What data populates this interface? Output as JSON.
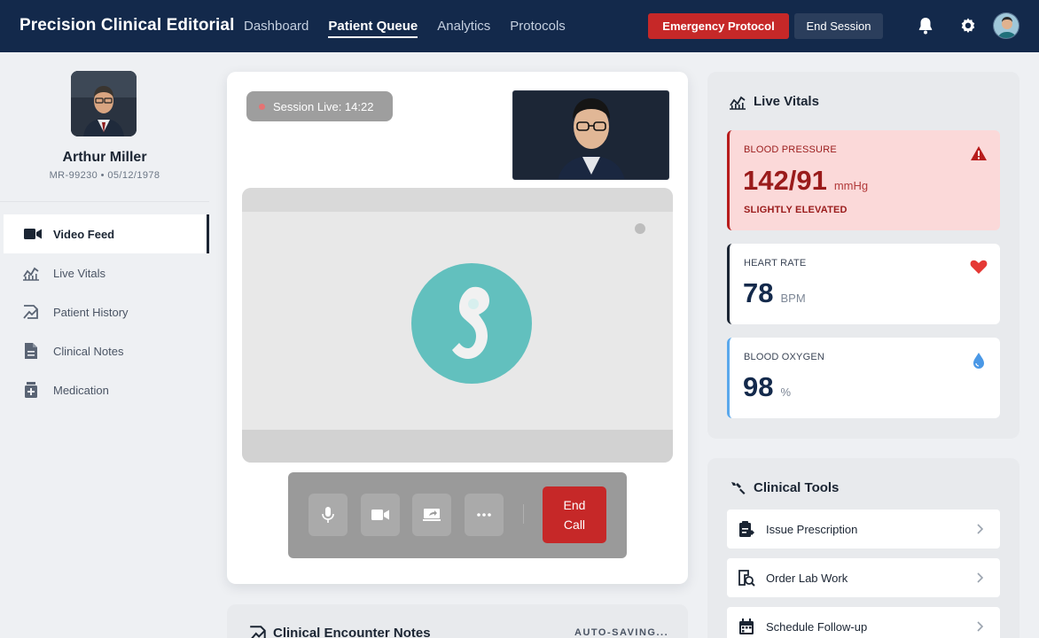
{
  "app": {
    "title": "Precision Clinical Editorial"
  },
  "nav": [
    {
      "label": "Dashboard",
      "active": false
    },
    {
      "label": "Patient Queue",
      "active": true
    },
    {
      "label": "Analytics",
      "active": false
    },
    {
      "label": "Protocols",
      "active": false
    }
  ],
  "header": {
    "emergency_label": "Emergency Protocol",
    "end_session_label": "End Session"
  },
  "patient": {
    "name": "Arthur Miller",
    "meta": "MR-99230 • 05/12/1978"
  },
  "sidebar": {
    "items": [
      {
        "label": "Video Feed",
        "icon": "video-icon",
        "active": true
      },
      {
        "label": "Live Vitals",
        "icon": "vitals-chart-icon",
        "active": false
      },
      {
        "label": "Patient History",
        "icon": "history-icon",
        "active": false
      },
      {
        "label": "Clinical Notes",
        "icon": "document-icon",
        "active": false
      },
      {
        "label": "Medication",
        "icon": "medication-icon",
        "active": false
      }
    ]
  },
  "video": {
    "session_label": "Session Live: 14:22",
    "end_call_label": "End\nCall"
  },
  "notes": {
    "title": "Clinical Encounter Notes",
    "status": "AUTO-SAVING..."
  },
  "vitals": {
    "title": "Live Vitals",
    "blood_pressure": {
      "label": "BLOOD PRESSURE",
      "value": "142/91",
      "unit": "mmHg",
      "status": "SLIGHTLY ELEVATED"
    },
    "heart_rate": {
      "label": "HEART RATE",
      "value": "78",
      "unit": "BPM"
    },
    "blood_oxygen": {
      "label": "BLOOD OXYGEN",
      "value": "98",
      "unit": "%"
    }
  },
  "tools": {
    "title": "Clinical Tools",
    "items": [
      {
        "label": "Issue Prescription",
        "icon": "prescription-icon"
      },
      {
        "label": "Order Lab Work",
        "icon": "lab-icon"
      },
      {
        "label": "Schedule Follow-up",
        "icon": "calendar-icon"
      }
    ]
  },
  "colors": {
    "navy": "#13294b",
    "emergency": "#c62828",
    "alert_bg": "#fbd9d9",
    "oxygen_accent": "#5aa8ec",
    "video_logo": "#62c0be"
  }
}
